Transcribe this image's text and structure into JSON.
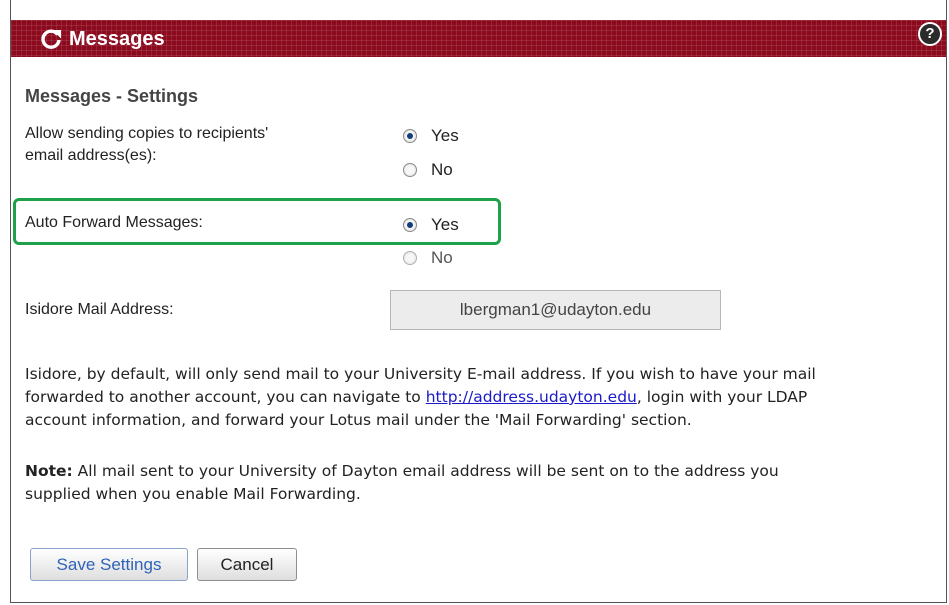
{
  "header": {
    "title": "Messages",
    "help_label": "?",
    "accent": "#8b0a1e"
  },
  "section_title": "Messages - Settings",
  "send_copies": {
    "label_line1": "Allow sending copies to recipients'",
    "label_line2": "email address(es):",
    "options": [
      "Yes",
      "No"
    ],
    "selected": "Yes"
  },
  "auto_forward": {
    "label": "Auto Forward Messages:",
    "options": [
      "Yes",
      "No"
    ],
    "selected": "Yes",
    "highlight_color": "#1fa04a"
  },
  "mail_address": {
    "label": "Isidore Mail Address:",
    "value": "lbergman1@udayton.edu"
  },
  "info": {
    "line1": "Isidore, by default, will only send mail to your University E-mail address. If you wish to have your mail",
    "line2_before": "forwarded to another account, you can navigate to ",
    "link": "http://address.udayton.edu",
    "line2_after": ", login with your LDAP",
    "line3": "account information, and forward your Lotus mail under the 'Mail Forwarding' section."
  },
  "note": {
    "label": "Note:",
    "line1": " All mail sent to your University of Dayton email address will be sent on to the address you",
    "line2": "supplied when you enable Mail Forwarding."
  },
  "buttons": {
    "save_label": "Save Settings",
    "cancel_label": "Cancel"
  }
}
